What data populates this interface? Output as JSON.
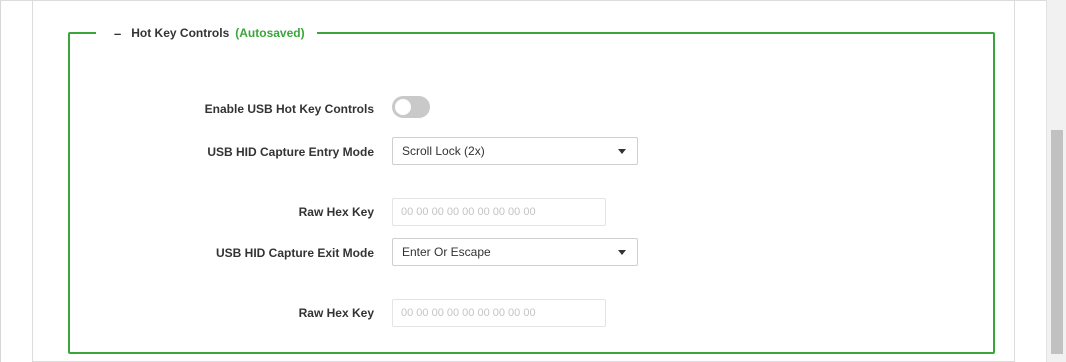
{
  "section": {
    "title": "Hot Key Controls",
    "status": "(Autosaved)",
    "collapse_symbol": "–"
  },
  "fields": {
    "enable_usb_hotkey": {
      "label": "Enable USB Hot Key Controls",
      "enabled": false
    },
    "entry_mode": {
      "label": "USB HID Capture Entry Mode",
      "value": "Scroll Lock (2x)"
    },
    "entry_raw_hex": {
      "label": "Raw Hex Key",
      "placeholder": "00 00 00 00 00 00 00 00 00",
      "value": ""
    },
    "exit_mode": {
      "label": "USB HID Capture Exit Mode",
      "value": "Enter Or Escape"
    },
    "exit_raw_hex": {
      "label": "Raw Hex Key",
      "placeholder": "00 00 00 00 00 00 00 00 00",
      "value": ""
    }
  },
  "icons": {
    "collapse": "minus-icon",
    "dropdown": "caret-down-icon"
  },
  "colors": {
    "accent_green": "#3aa53a",
    "toggle_off": "#c9c9c9",
    "label_text": "#333333",
    "placeholder_text": "#c4c4c4"
  }
}
